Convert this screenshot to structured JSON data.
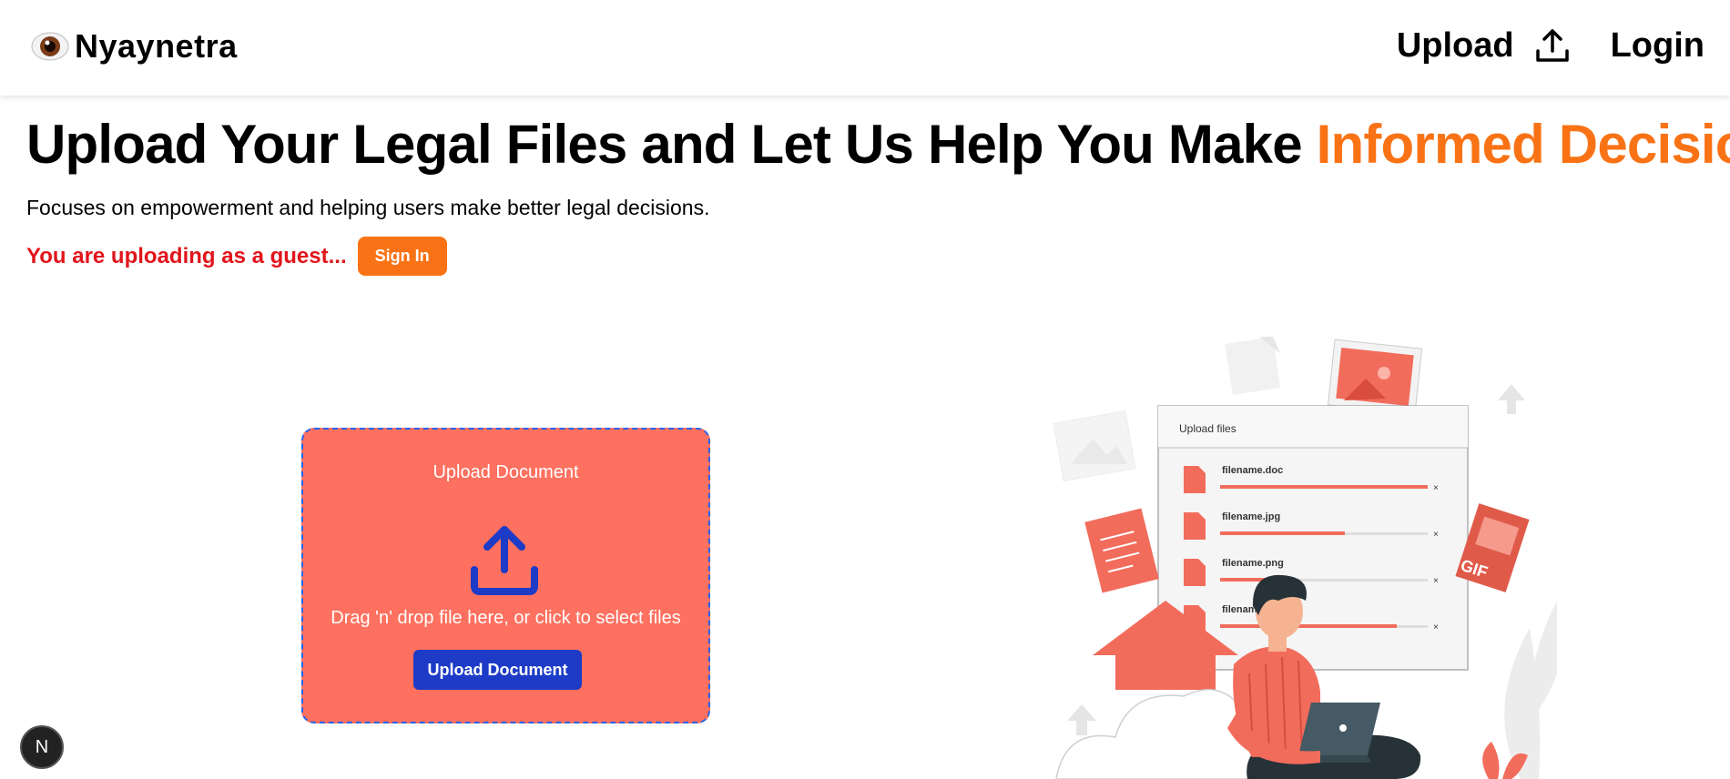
{
  "navbar": {
    "brand_name": "Nyaynetra",
    "upload_label": "Upload",
    "login_label": "Login"
  },
  "hero": {
    "title_main": "Upload Your Legal Files and Let Us Help You Make ",
    "title_accent": "Informed Decisions",
    "subtitle": "Focuses on empowerment and helping users make better legal decisions.",
    "guest_text": "You are uploading as a guest...",
    "signin_label": "Sign In"
  },
  "upload_card": {
    "title": "Upload Document",
    "hint": "Drag 'n' drop file here, or click to select files",
    "button_label": "Upload Document"
  },
  "illustration": {
    "panel_title": "Upload files",
    "files": [
      {
        "name": "filename.doc",
        "progress": 1.0
      },
      {
        "name": "filename.jpg",
        "progress": 0.6
      },
      {
        "name": "filename.png",
        "progress": 0.25
      },
      {
        "name": "filename",
        "progress": 0.85
      }
    ],
    "badge": "GIF"
  },
  "floating_button": {
    "label": "N"
  },
  "colors": {
    "accent_orange": "#f97316",
    "guest_red": "#e0151b",
    "card_coral": "#fe705f",
    "button_blue": "#1d3bc6",
    "dashed_border": "#2563eb"
  },
  "icons": {
    "brand": "eye-icon",
    "nav_upload": "upload-icon",
    "card_upload": "upload-icon"
  }
}
